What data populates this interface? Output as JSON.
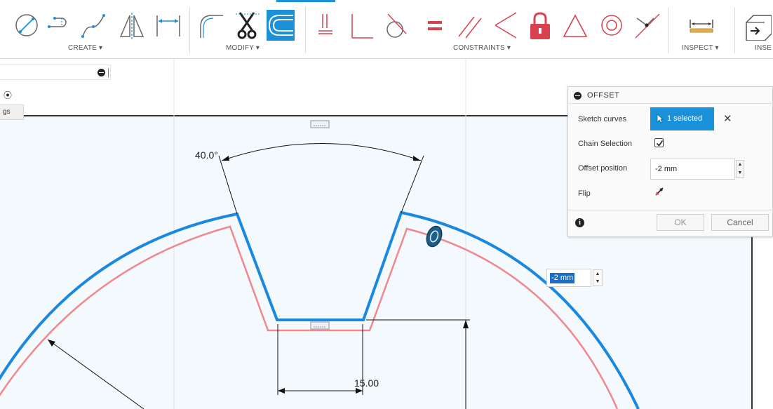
{
  "toolbar": {
    "groups": {
      "create": "CREATE",
      "modify": "MODIFY",
      "constraints": "CONSTRAINTS",
      "inspect": "INSPECT",
      "insert": "INSE"
    },
    "dropdown_glyph": "▾",
    "active_tool": "offset-tool",
    "accent": "#1a91d9",
    "constraint_red": "#d9414f"
  },
  "browser": {
    "settings_tab": "gs"
  },
  "sketch": {
    "angle_dimension": "40.0°",
    "width_dimension": "15.00",
    "selected_color": "#1a87e0",
    "offset_preview_color": "#f0888e"
  },
  "offset_dialog": {
    "title": "OFFSET",
    "sketch_curves_label": "Sketch curves",
    "selection_button": "1 selected",
    "clear_glyph": "✕",
    "chain_selection_label": "Chain Selection",
    "chain_selection_checked": true,
    "offset_position_label": "Offset position",
    "offset_value": "-2 mm",
    "flip_label": "Flip",
    "info_glyph": "i",
    "ok_label": "OK",
    "cancel_label": "Cancel"
  },
  "floating_input": {
    "value": "-2 mm"
  }
}
